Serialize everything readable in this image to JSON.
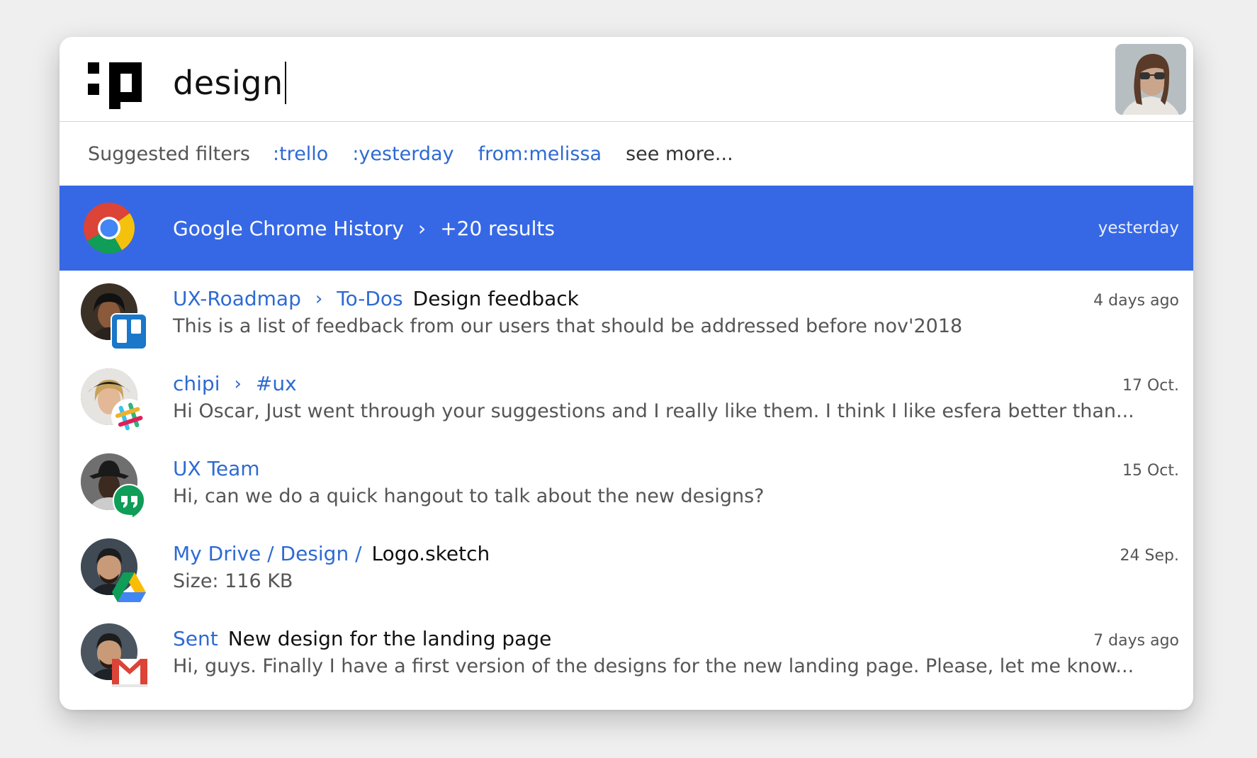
{
  "search": {
    "query": "design"
  },
  "filters": {
    "label": "Suggested filters",
    "items": [
      ":trello",
      ":yesterday",
      "from:melissa"
    ],
    "more": "see more..."
  },
  "highlight": {
    "source": "Google Chrome History",
    "separator": "›",
    "count": "+20 results",
    "time": "yesterday",
    "icon": "chrome-icon"
  },
  "results": [
    {
      "path": [
        "UX-Roadmap",
        "To-Dos"
      ],
      "title": "Design feedback",
      "snippet": "This is a list of feedback from our users that should be addressed before nov'2018",
      "time": "4 days ago",
      "app_icon": "trello-icon"
    },
    {
      "path": [
        "chipi",
        "#ux"
      ],
      "title": "",
      "snippet": "Hi Oscar, Just went through your suggestions and I really like them. I think I like esfera better than...",
      "time": "17 Oct.",
      "app_icon": "slack-icon"
    },
    {
      "path": [
        "UX Team"
      ],
      "title": "",
      "snippet": "Hi, can we do a quick hangout to talk about the new designs?",
      "time": "15 Oct.",
      "app_icon": "hangouts-icon"
    },
    {
      "path_text": "My Drive / Design /",
      "title": "Logo.sketch",
      "snippet": "Size: 116 KB",
      "time": "24 Sep.",
      "app_icon": "google-drive-icon"
    },
    {
      "path": [
        "Sent"
      ],
      "title": "New design for the landing page",
      "snippet": "Hi, guys. Finally I have a first version of the designs for the new landing page. Please, let me know...",
      "time": "7 days ago",
      "app_icon": "gmail-icon"
    }
  ],
  "colors": {
    "highlight": "#3668e6",
    "link": "#2e6ad3"
  }
}
